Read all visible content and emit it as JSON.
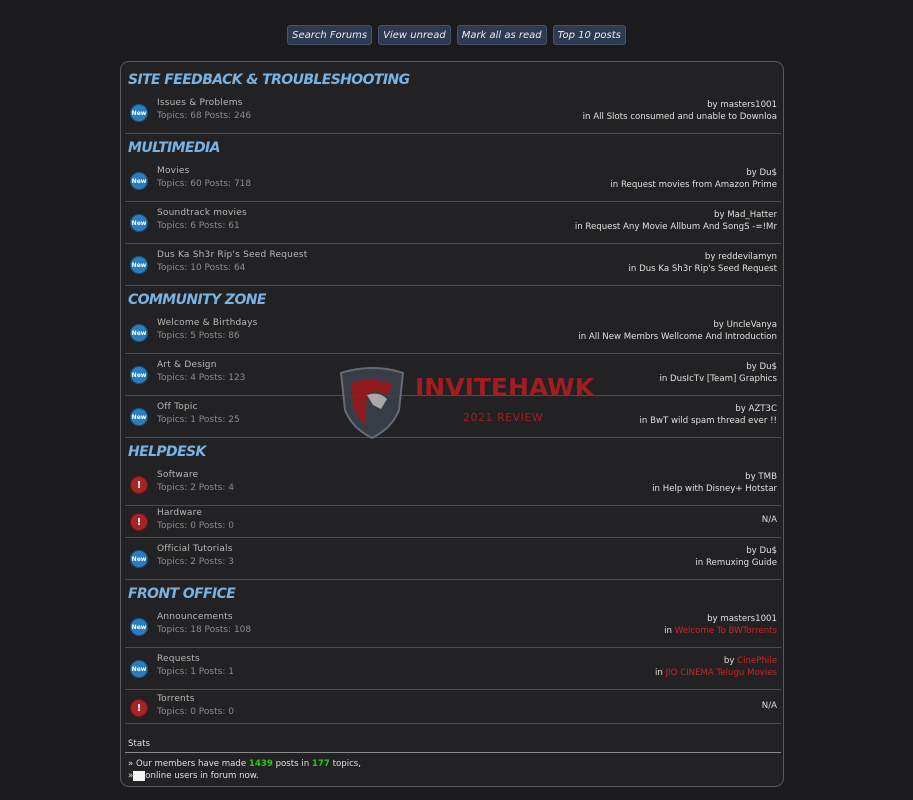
{
  "toolbar": {
    "search_forums": "Search Forums",
    "view_unread": "View unread",
    "mark_all_read": "Mark all as read",
    "top_10": "Top 10 posts"
  },
  "sections": [
    {
      "title": "SITE FEEDBACK & TROUBLESHOOTING",
      "forums": [
        {
          "name": "Issues & Problems",
          "stats": "Topics: 68 Posts: 246",
          "icon": "new-icon",
          "icon_text": "New",
          "by": "by masters1001",
          "in": "in All Slots consumed and unable to Downloa"
        }
      ]
    },
    {
      "title": "MULTIMEDIA",
      "forums": [
        {
          "name": "Movies",
          "stats": "Topics: 60 Posts: 718",
          "icon": "new-icon",
          "icon_text": "New",
          "by": "by Du$",
          "in": "in Request movies from Amazon Prime"
        },
        {
          "name": "Soundtrack movies",
          "stats": "Topics: 6 Posts: 61",
          "icon": "new-icon",
          "icon_text": "New",
          "by": "by Mad_Hatter",
          "in": "in Request Any Movie Allbum And SongS -=!Mr"
        },
        {
          "name": "Dus Ka Sh3r Rip's Seed Request",
          "stats": "Topics: 10 Posts: 64",
          "icon": "new-icon",
          "icon_text": "New",
          "by": "by reddevilamyn",
          "in": "in Dus Ka Sh3r Rip's Seed Request"
        }
      ]
    },
    {
      "title": "COMMUNITY ZONE",
      "forums": [
        {
          "name": "Welcome & Birthdays",
          "stats": "Topics: 5 Posts: 86",
          "icon": "new-icon",
          "icon_text": "New",
          "by": "by UncleVanya",
          "in": "in All New Membrs Wellcome And Introduction"
        },
        {
          "name": "Art & Design",
          "stats": "Topics: 4 Posts: 123",
          "icon": "new-icon",
          "icon_text": "New",
          "by": "by Du$",
          "in": "in DusIcTv [Team] Graphics"
        },
        {
          "name": "Off Topic",
          "stats": "Topics: 1 Posts: 25",
          "icon": "new-icon",
          "icon_text": "New",
          "by": "by AZT3C",
          "in": "in BwT wild spam thread ever !!"
        }
      ]
    },
    {
      "title": "HELPDESK",
      "forums": [
        {
          "name": "Software",
          "stats": "Topics: 2 Posts: 4",
          "icon": "alert-icon",
          "icon_text": "!",
          "by": "by TMB",
          "in": "in Help with Disney+ Hotstar"
        },
        {
          "name": "Hardware",
          "stats": "Topics: 0 Posts: 0",
          "icon": "alert-icon",
          "icon_text": "!",
          "na": "N/A"
        },
        {
          "name": "Official Tutorials",
          "stats": "Topics: 2 Posts: 3",
          "icon": "new-icon",
          "icon_text": "New",
          "by": "by Du$",
          "in": "in Remuxing Guide"
        }
      ]
    },
    {
      "title": "FRONT OFFICE",
      "forums": [
        {
          "name": "Announcements",
          "stats": "Topics: 18 Posts: 108",
          "icon": "new-icon",
          "icon_text": "New",
          "by": "by masters1001",
          "in_prefix": "in ",
          "in_link": "Welcome To BWTorrents"
        },
        {
          "name": "Requests",
          "stats": "Topics: 1 Posts: 1",
          "icon": "new-icon",
          "icon_text": "New",
          "by_prefix": "by ",
          "by_link": "CinePhile",
          "in_prefix": "in ",
          "in_link": "JIO CINEMA Telugu Movies"
        },
        {
          "name": "Torrents",
          "stats": "Topics: 0 Posts: 0",
          "icon": "alert-icon",
          "icon_text": "!",
          "na": "N/A"
        }
      ]
    }
  ],
  "stats": {
    "label": "Stats",
    "line1_a": "» Our members have made ",
    "posts": "1439",
    "line1_b": " posts in ",
    "topics": "177",
    "line1_c": " topics,",
    "line2_a": "»",
    "line2_b": "online users in forum now."
  },
  "watermark": {
    "brand": "INVITEHAWK",
    "sub": "2021 REVIEW"
  }
}
